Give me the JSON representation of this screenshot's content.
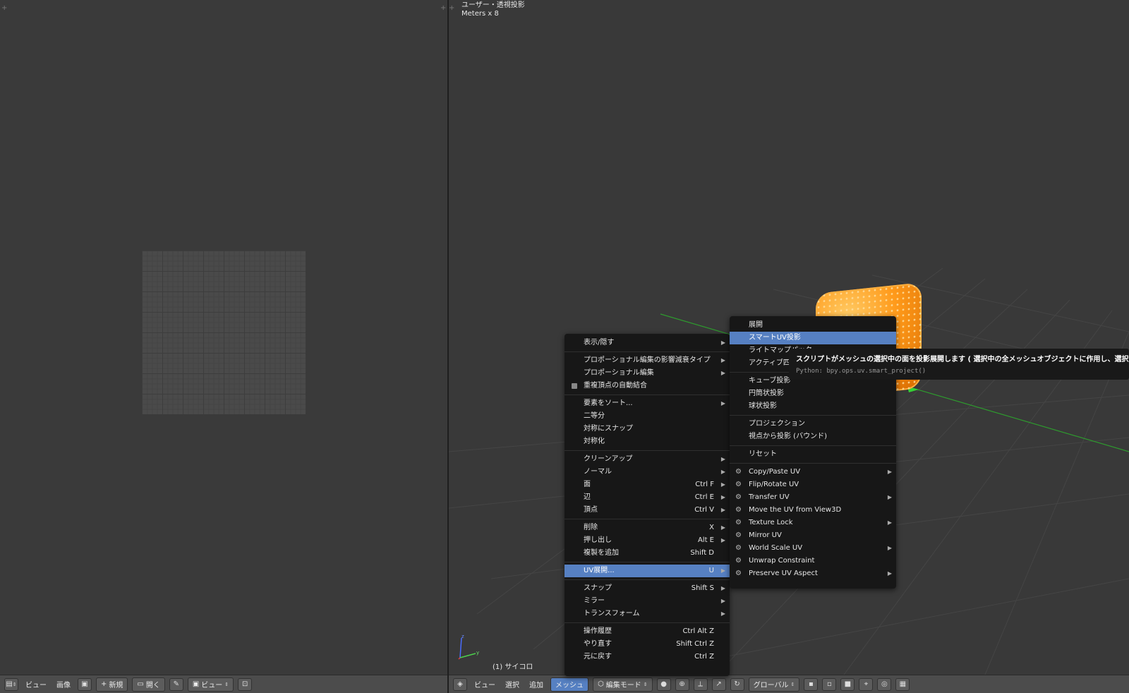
{
  "viewport": {
    "view_name": "ユーザー・透視投影",
    "scale": "Meters x 8",
    "object_label": "(1) サイコロ"
  },
  "uv_header": {
    "items": [
      "ビュー",
      "画像"
    ],
    "new_label": "新規",
    "open_label": "開く",
    "view_label": "ビュー"
  },
  "vp_header": {
    "items": [
      "ビュー",
      "選択",
      "追加"
    ],
    "active_menu": "メッシュ",
    "mode_label": "編集モード",
    "orientation_label": "グローバル"
  },
  "mesh_menu": {
    "items": [
      {
        "label": "表示/隠す",
        "submenu": true
      },
      {
        "sep": true
      },
      {
        "label": "プロポーショナル編集の影響減衰タイプ",
        "submenu": true
      },
      {
        "label": "プロポーショナル編集",
        "submenu": true
      },
      {
        "label": "重複頂点の自動結合",
        "checkbox": true
      },
      {
        "sep": true
      },
      {
        "label": "要素をソート...",
        "submenu": true
      },
      {
        "label": "二等分"
      },
      {
        "label": "対称にスナップ"
      },
      {
        "label": "対称化"
      },
      {
        "sep": true
      },
      {
        "label": "クリーンアップ",
        "submenu": true
      },
      {
        "label": "ノーマル",
        "submenu": true
      },
      {
        "label": "面",
        "shortcut": "Ctrl F",
        "submenu": true
      },
      {
        "label": "辺",
        "shortcut": "Ctrl E",
        "submenu": true
      },
      {
        "label": "頂点",
        "shortcut": "Ctrl V",
        "submenu": true
      },
      {
        "sep": true
      },
      {
        "label": "削除",
        "shortcut": "X",
        "submenu": true
      },
      {
        "label": "押し出し",
        "shortcut": "Alt E",
        "submenu": true
      },
      {
        "label": "複製を追加",
        "shortcut": "Shift D"
      },
      {
        "sep": true
      },
      {
        "label": "UV展開...",
        "shortcut": "U",
        "submenu": true,
        "highlight": true
      },
      {
        "sep": true
      },
      {
        "label": "スナップ",
        "shortcut": "Shift S",
        "submenu": true
      },
      {
        "label": "ミラー",
        "submenu": true
      },
      {
        "label": "トランスフォーム",
        "submenu": true
      },
      {
        "sep": true
      },
      {
        "label": "操作履歴",
        "shortcut": "Ctrl Alt Z"
      },
      {
        "label": "やり直す",
        "shortcut": "Shift Ctrl Z"
      },
      {
        "label": "元に戻す",
        "shortcut": "Ctrl Z"
      }
    ]
  },
  "uv_submenu": {
    "items": [
      {
        "label": "展開"
      },
      {
        "label": "スマートUV投影",
        "highlight": true
      },
      {
        "label": "ライトマップパック"
      },
      {
        "label": "アクティブ四辺形面に追従"
      },
      {
        "sep": true
      },
      {
        "label": "キューブ投影"
      },
      {
        "label": "円筒状投影"
      },
      {
        "label": "球状投影"
      },
      {
        "sep": true
      },
      {
        "label": "プロジェクション"
      },
      {
        "label": "視点から投影 (バウンド)"
      },
      {
        "sep": true
      },
      {
        "label": "リセット"
      },
      {
        "sep": true
      },
      {
        "label": "Copy/Paste UV",
        "addon": true,
        "submenu": true
      },
      {
        "label": "Flip/Rotate UV",
        "addon": true
      },
      {
        "label": "Transfer UV",
        "addon": true,
        "submenu": true
      },
      {
        "label": "Move the UV from View3D",
        "addon": true
      },
      {
        "label": "Texture Lock",
        "addon": true,
        "submenu": true
      },
      {
        "label": "Mirror UV",
        "addon": true
      },
      {
        "label": "World Scale UV",
        "addon": true,
        "submenu": true
      },
      {
        "label": "Unwrap Constraint",
        "addon": true
      },
      {
        "label": "Preserve UV Aspect",
        "addon": true,
        "submenu": true
      }
    ]
  },
  "tooltip": {
    "text": "スクリプトがメッシュの選択中の面を投影展開します ( 選択中の全メッシュオブジェクトに作用し、選択",
    "python": "Python: bpy.ops.uv.smart_project()"
  },
  "colors": {
    "highlight": "#5680c2",
    "menu_bg": "#171717",
    "viewport_bg": "#393939",
    "selection": "#ff9a1a"
  },
  "icons": [
    "editor-type-icon",
    "image-icon",
    "plus-icon",
    "folder-icon",
    "pin-icon",
    "addon-script-icon",
    "manipulator-icon",
    "pivot-icon",
    "snap-icon"
  ]
}
